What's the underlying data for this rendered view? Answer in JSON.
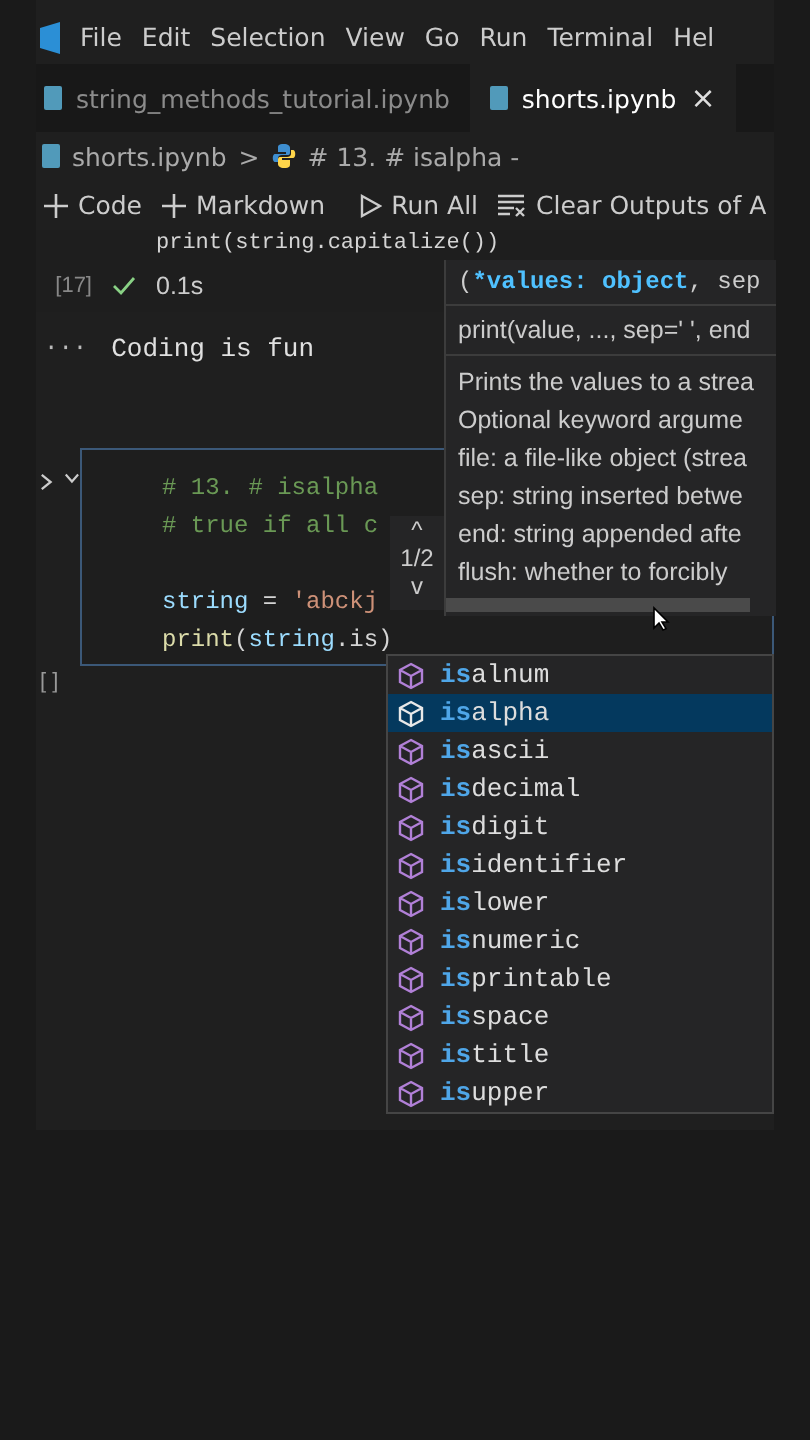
{
  "menu": [
    "File",
    "Edit",
    "Selection",
    "View",
    "Go",
    "Run",
    "Terminal",
    "Hel"
  ],
  "tabs": [
    {
      "label": "string_methods_tutorial.ipynb",
      "selected": false
    },
    {
      "label": "shorts.ipynb",
      "selected": true,
      "close": "×"
    }
  ],
  "breadcrumb": {
    "file": "shorts.ipynb",
    "separator": ">",
    "symbol": "# 13. # isalpha -"
  },
  "toolbar": [
    {
      "kind": "add",
      "label": "Code"
    },
    {
      "kind": "add",
      "label": "Markdown"
    },
    {
      "kind": "run",
      "label": "Run All"
    },
    {
      "kind": "clear",
      "label": "Clear Outputs of A"
    }
  ],
  "previous_cell": {
    "code": "print(string.capitalize())",
    "execution_count": "[17]",
    "status": "0.1s",
    "output_more": "···",
    "output": "Coding is fun"
  },
  "current_cell": {
    "execution_count": "[ ]",
    "lines": [
      {
        "kind": "code",
        "tokens": [
          {
            "kind": "comment",
            "text": "# 13. # isalpha"
          }
        ]
      },
      {
        "kind": "code",
        "tokens": [
          {
            "kind": "comment",
            "text": "# true if all c"
          }
        ]
      },
      {
        "kind": "blank"
      },
      {
        "kind": "code",
        "tokens": [
          {
            "kind": "variable",
            "text": "string"
          },
          {
            "kind": "plain",
            "text": " = "
          },
          {
            "kind": "string",
            "text": "'abckj"
          }
        ]
      },
      {
        "kind": "code",
        "tokens": [
          {
            "kind": "function",
            "text": "print"
          },
          {
            "kind": "plain",
            "text": "("
          },
          {
            "kind": "variable",
            "text": "string"
          },
          {
            "kind": "plain",
            "text": ".is)"
          }
        ]
      }
    ]
  },
  "hover": {
    "overload": "1/2",
    "up": "^",
    "down": "v",
    "signature": [
      {
        "kind": "plain",
        "text": "("
      },
      {
        "kind": "active",
        "text": "*values: object"
      },
      {
        "kind": "plain",
        "text": ", sep"
      }
    ],
    "usage": "print(value, ..., sep=' ', end",
    "doc": [
      "Prints the values to a strea",
      "Optional keyword argume",
      "file: a file-like object (strea",
      "sep: string inserted betwe",
      "end: string appended afte",
      "flush: whether to forcibly"
    ]
  },
  "suggestions": {
    "items": [
      {
        "prefix": "is",
        "rest": "alnum",
        "selected": false
      },
      {
        "prefix": "is",
        "rest": "alpha",
        "selected": true
      },
      {
        "prefix": "is",
        "rest": "ascii",
        "selected": false
      },
      {
        "prefix": "is",
        "rest": "decimal",
        "selected": false
      },
      {
        "prefix": "is",
        "rest": "digit",
        "selected": false
      },
      {
        "prefix": "is",
        "rest": "identifier",
        "selected": false
      },
      {
        "prefix": "is",
        "rest": "lower",
        "selected": false
      },
      {
        "prefix": "is",
        "rest": "numeric",
        "selected": false
      },
      {
        "prefix": "is",
        "rest": "printable",
        "selected": false
      },
      {
        "prefix": "is",
        "rest": "space",
        "selected": false
      },
      {
        "prefix": "is",
        "rest": "title",
        "selected": false
      },
      {
        "prefix": "is",
        "rest": "upper",
        "selected": false
      }
    ]
  }
}
